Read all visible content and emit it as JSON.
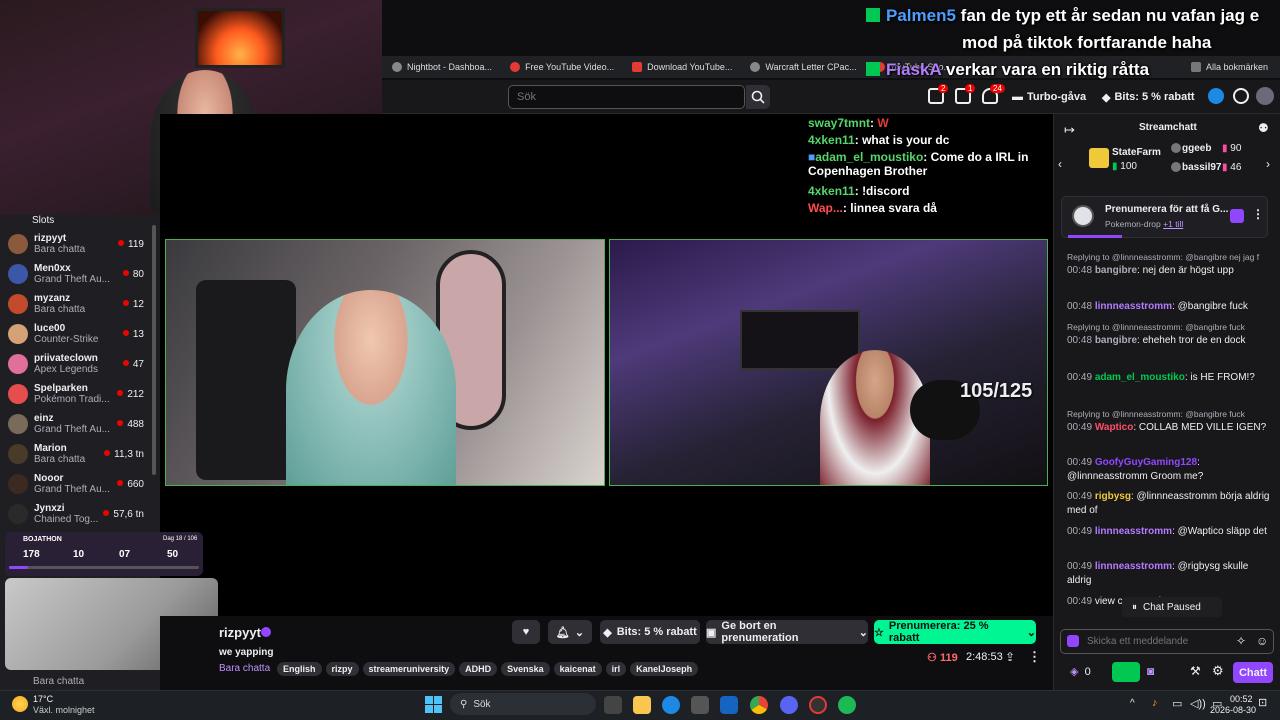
{
  "overlay_chat": [
    {
      "user": "Palmen5",
      "text": "fan de typ ett år sedan nu vafan jag e"
    },
    {
      "user": "",
      "text": "mod på tiktok fortfarande haha"
    },
    {
      "user": "FiaskA",
      "text": "verkar vara en riktig råtta"
    }
  ],
  "bookmarks": [
    {
      "label": "Nightbot - Dashboa..."
    },
    {
      "label": "Free YouTube Video..."
    },
    {
      "label": "Download YouTube..."
    },
    {
      "label": "Warcraft Letter CPac..."
    },
    {
      "label": "YouTube Sho..."
    },
    {
      "label": "Alla bokmärken"
    }
  ],
  "header": {
    "search_placeholder": "Sök",
    "notif_counts": [
      "2",
      "1",
      "24"
    ],
    "turbo_label": "Turbo-gåva",
    "bits_label": "Bits: 5 % rabatt"
  },
  "sidebar": {
    "top_label": "Slots",
    "items": [
      {
        "name": "rizpyyt",
        "game": "Bara chatta",
        "viewers": "119",
        "color": "#8b5a3c"
      },
      {
        "name": "Men0xx",
        "game": "Grand Theft Au...",
        "viewers": "80",
        "color": "#3a57a8"
      },
      {
        "name": "myzanz",
        "game": "Bara chatta",
        "viewers": "12",
        "color": "#c44a2c"
      },
      {
        "name": "luce00",
        "game": "Counter-Strike",
        "viewers": "13",
        "color": "#d4a276"
      },
      {
        "name": "priivateclown",
        "game": "Apex Legends",
        "viewers": "47",
        "color": "#e0709a"
      },
      {
        "name": "Spelparken",
        "game": "Pokémon Tradi...",
        "viewers": "212",
        "color": "#e84d4d"
      },
      {
        "name": "einz",
        "game": "Grand Theft Au...",
        "viewers": "488",
        "color": "#7a6a5a"
      },
      {
        "name": "Marion",
        "game": "Bara chatta",
        "viewers": "11,3 tn",
        "color": "#4a3a2a"
      },
      {
        "name": "Nooor",
        "game": "Grand Theft Au...",
        "viewers": "660",
        "color": "#3a2a22"
      },
      {
        "name": "Jynxzi",
        "game": "Chained Tog...",
        "viewers": "57,6 tn",
        "color": "#2a2a2a"
      }
    ],
    "bottom_game": "Bara chatta"
  },
  "video": {
    "counter": "105/125",
    "video_chat": [
      {
        "user": "sway7tmnt",
        "text": "",
        "color": "#54d66b"
      },
      {
        "user": "4xken11",
        "text": "what is your dc",
        "color": "#54d66b"
      },
      {
        "user": "adam_el_moustiko",
        "text": "Come do a IRL in Copenhagen Brother",
        "color": "#54d66b"
      },
      {
        "user": "4xken11",
        "text": "!discord",
        "color": "#54d66b"
      },
      {
        "user": "Wap...",
        "text": "linnea svara då",
        "color": "#ff4d4d"
      }
    ]
  },
  "bojathon": {
    "title": "BOJATHON",
    "day": "Dag 18 / 106",
    "stats": [
      "178",
      "10",
      "07",
      "50"
    ]
  },
  "stream_info": {
    "channel": "rizpyyt",
    "title": "we yapping",
    "category": "Bara chatta",
    "tags": [
      "English",
      "rizpy",
      "streameruniversity",
      "ADHD",
      "Svenska",
      "kaicenat",
      "irl",
      "KanelJoseph"
    ],
    "viewers": "119",
    "uptime": "2:48:53",
    "bits_button": "Bits: 5 % rabatt",
    "gift_button": "Ge bort en prenumeration",
    "subscribe_button": "Prenumerera: 25 % rabatt"
  },
  "chat": {
    "title": "Streamchatt",
    "leaderboard": [
      {
        "name": "StateFarm",
        "value": "100"
      },
      {
        "name": "ggeeb",
        "value": "90"
      },
      {
        "name": "bassil97",
        "value": "46"
      }
    ],
    "promo_title": "Prenumerera för att få G...",
    "promo_sub": "Pokemon-drop",
    "promo_more": "+1 till",
    "messages": [
      {
        "reply": "Replying to @linnneasstromm: @bangibre nej jag f",
        "time": "00:48",
        "user": "bangibre",
        "cls": "u-b",
        "text": "nej den är högst upp"
      },
      {
        "reply": "",
        "time": "00:48",
        "user": "linnneasstromm",
        "cls": "u-p",
        "text": "@bangibre fuck"
      },
      {
        "reply": "Replying to @linnneasstromm: @bangibre fuck",
        "time": "00:48",
        "user": "bangibre",
        "cls": "u-b",
        "text": "eheheh tror de     en dock"
      },
      {
        "reply": "",
        "time": "00:49",
        "user": "adam_el_moustiko",
        "cls": "u-g",
        "text": "is HE FROM!?"
      },
      {
        "reply": "Replying to @linnneasstromm: @bangibre fuck",
        "time": "00:49",
        "user": "Waptico",
        "cls": "u-r",
        "text": "COLLAB MED VILLE IGEN?"
      },
      {
        "reply": "",
        "time": "00:49",
        "user": "GoofyGuyGaming128",
        "cls": "u-v",
        "text": "@linnneasstromm Groom me?"
      },
      {
        "reply": "",
        "time": "00:49",
        "user": "rigbysg",
        "cls": "u-y",
        "text": "@linnneasstromm börja aldrig med of"
      },
      {
        "reply": "",
        "time": "00:49",
        "user": "linnneasstromm",
        "cls": "u-p",
        "text": "@Waptico släpp det"
      },
      {
        "reply": "",
        "time": "00:49",
        "user": "linnneasstromm",
        "cls": "u-p",
        "text": "@rigbysg skulle aldrig"
      },
      {
        "reply": "",
        "time": "00:49",
        "user": "",
        "cls": "u-b",
        "text": "view count make every v"
      }
    ],
    "paused_label": "Chat Paused",
    "input_placeholder": "Skicka ett meddelande",
    "points": "0",
    "send_label": "Chatt"
  },
  "taskbar": {
    "weather_temp": "17°C",
    "weather_desc": "Växl. molnighet",
    "search_label": "Sök",
    "time": "00:52",
    "date": "2026-08-30"
  }
}
